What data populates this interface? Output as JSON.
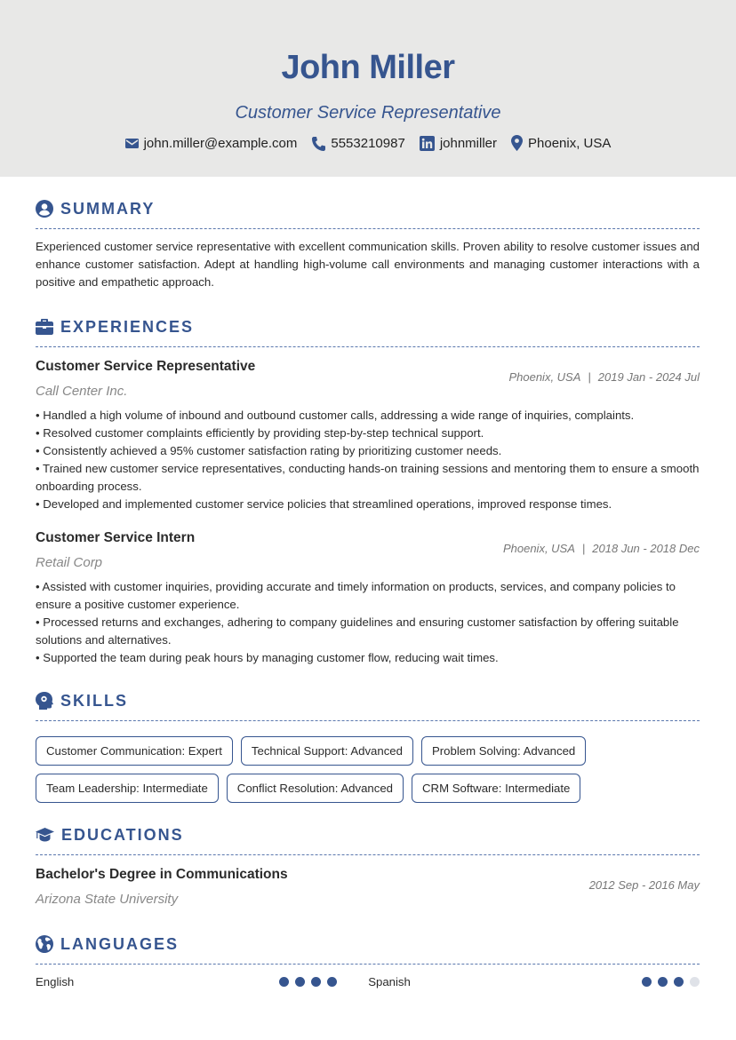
{
  "header": {
    "name": "John Miller",
    "title": "Customer Service Representative",
    "contacts": [
      {
        "icon": "envelope-icon",
        "value": "john.miller@example.com"
      },
      {
        "icon": "phone-icon",
        "value": "5553210987"
      },
      {
        "icon": "linkedin-icon",
        "value": "johnmiller"
      },
      {
        "icon": "location-pin-icon",
        "value": "Phoenix, USA"
      }
    ]
  },
  "colors": {
    "accent": "#36558f",
    "header_bg": "#e8e8e7",
    "muted": "#777777",
    "dot_off": "#dfe2e8"
  },
  "summary": {
    "heading": "SUMMARY",
    "icon": "user-circle-icon",
    "text": "Experienced customer service representative with excellent communication skills. Proven ability to resolve customer issues and enhance customer satisfaction. Adept at handling high-volume call environments and managing customer interactions with a positive and empathetic approach."
  },
  "experiences": {
    "heading": "EXPERIENCES",
    "icon": "briefcase-icon",
    "items": [
      {
        "role": "Customer Service Representative",
        "company": "Call Center Inc.",
        "location": "Phoenix, USA",
        "separator": "|",
        "dates": "2019 Jan - 2024 Jul",
        "bullets": [
          "• Handled a high volume of inbound and outbound customer calls, addressing a wide range of inquiries, complaints.",
          "• Resolved customer complaints efficiently by providing step-by-step technical support.",
          "• Consistently achieved a 95% customer satisfaction rating by prioritizing customer needs.",
          "• Trained new customer service representatives, conducting hands-on training sessions and mentoring them to ensure a smooth onboarding process.",
          "• Developed and implemented customer service policies that streamlined operations, improved response times."
        ]
      },
      {
        "role": "Customer Service Intern",
        "company": "Retail Corp",
        "location": "Phoenix, USA",
        "separator": "|",
        "dates": "2018 Jun - 2018 Dec",
        "bullets": [
          "• Assisted with customer inquiries, providing accurate and timely information on products, services, and company policies to ensure a positive customer experience.",
          "• Processed returns and exchanges, adhering to company guidelines and ensuring customer satisfaction by offering suitable solutions and alternatives.",
          "• Supported the team during peak hours by managing customer flow, reducing wait times."
        ]
      }
    ]
  },
  "skills": {
    "heading": "SKILLS",
    "icon": "brain-head-icon",
    "items": [
      "Customer Communication: Expert",
      "Technical Support: Advanced",
      "Problem Solving: Advanced",
      "Team Leadership: Intermediate",
      "Conflict Resolution: Advanced",
      "CRM Software: Intermediate"
    ]
  },
  "educations": {
    "heading": "EDUCATIONS",
    "icon": "graduation-cap-icon",
    "items": [
      {
        "degree": "Bachelor's Degree in Communications",
        "school": "Arizona State University",
        "dates": "2012 Sep - 2016 May"
      }
    ]
  },
  "languages": {
    "heading": "LANGUAGES",
    "icon": "globe-icon",
    "items": [
      {
        "name": "English",
        "level": 4,
        "max": 4
      },
      {
        "name": "Spanish",
        "level": 3,
        "max": 4
      }
    ]
  }
}
